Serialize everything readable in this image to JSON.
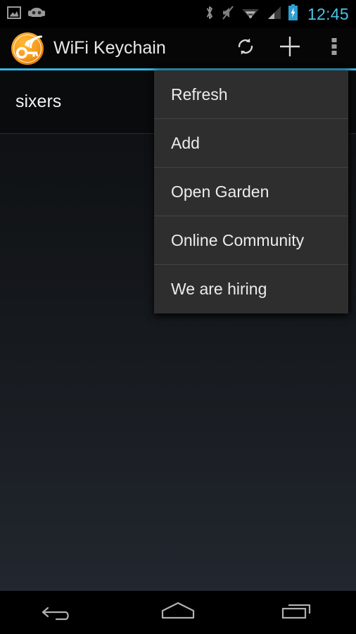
{
  "status_bar": {
    "left_icons": [
      {
        "name": "screenshot-icon",
        "label": "Screenshot"
      },
      {
        "name": "android-head-icon",
        "label": "CyanogenMod"
      }
    ],
    "right_icons": [
      {
        "name": "bluetooth-icon",
        "label": "Bluetooth"
      },
      {
        "name": "silent-mode-icon",
        "label": "Ringer silenced"
      },
      {
        "name": "wifi-icon",
        "label": "Wi-Fi connected"
      },
      {
        "name": "cellular-signal-icon",
        "label": "Cellular signal"
      },
      {
        "name": "battery-charging-icon",
        "label": "Battery charging"
      }
    ],
    "clock": "12:45",
    "clock_color": "#4cc3e8"
  },
  "action_bar": {
    "app_icon_name": "wifi-keychain-logo",
    "title": "WiFi Keychain",
    "accent_color": "#33b5e5",
    "buttons": [
      {
        "name": "refresh-button",
        "label": "Refresh"
      },
      {
        "name": "add-button",
        "label": "Add"
      },
      {
        "name": "overflow-menu-button",
        "label": "More options"
      }
    ]
  },
  "wifi_list": {
    "items": [
      {
        "ssid": "sixers"
      }
    ]
  },
  "overflow_menu": {
    "background_color": "#2e2e2e",
    "items": [
      {
        "label": "Refresh",
        "name": "menu-item-refresh"
      },
      {
        "label": "Add",
        "name": "menu-item-add"
      },
      {
        "label": "Open Garden",
        "name": "menu-item-open-garden"
      },
      {
        "label": "Online Community",
        "name": "menu-item-online-community"
      },
      {
        "label": "We are hiring",
        "name": "menu-item-we-are-hiring"
      }
    ]
  },
  "nav_bar": {
    "buttons": [
      {
        "name": "back-button",
        "label": "Back"
      },
      {
        "name": "home-button",
        "label": "Home"
      },
      {
        "name": "recents-button",
        "label": "Recent apps"
      }
    ]
  }
}
